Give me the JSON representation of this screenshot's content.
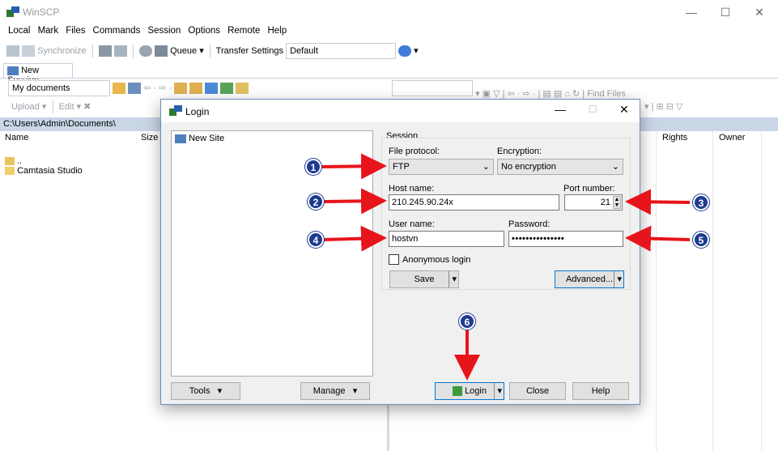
{
  "app": {
    "title": "WinSCP"
  },
  "menu": [
    "Local",
    "Mark",
    "Files",
    "Commands",
    "Session",
    "Options",
    "Remote",
    "Help"
  ],
  "toolbar1": {
    "synchronize": "Synchronize",
    "queue": "Queue",
    "transfer_label": "Transfer Settings",
    "transfer_value": "Default"
  },
  "tab": {
    "label": "New Session"
  },
  "local": {
    "location": "My documents",
    "upload": "Upload",
    "edit": "Edit",
    "path": "C:\\Users\\Admin\\Documents\\",
    "columns": [
      "Name",
      "Size"
    ],
    "items": [
      {
        "name": ".."
      },
      {
        "name": "Camtasia Studio"
      }
    ]
  },
  "remote": {
    "find_files": "Find Files",
    "columns": [
      "Rights",
      "Owner"
    ]
  },
  "dialog": {
    "title": "Login",
    "site": "New Site",
    "session_label": "Session",
    "protocol_label": "File protocol:",
    "protocol_value": "FTP",
    "encryption_label": "Encryption:",
    "encryption_value": "No encryption",
    "host_label": "Host name:",
    "host_value": "210.245.90.24x",
    "port_label": "Port number:",
    "port_value": "21",
    "user_label": "User name:",
    "user_value": "hostvn",
    "password_label": "Password:",
    "password_value": "•••••••••••••••",
    "anonymous_label": "Anonymous login",
    "save": "Save",
    "advanced": "Advanced...",
    "tools": "Tools",
    "manage": "Manage",
    "login": "Login",
    "close": "Close",
    "help": "Help"
  },
  "annotations": [
    "1",
    "2",
    "3",
    "4",
    "5",
    "6"
  ],
  "colors": {
    "arrow": "#e8141b",
    "badge": "#1f3b8f",
    "pathbar": "#c9d6e6"
  }
}
